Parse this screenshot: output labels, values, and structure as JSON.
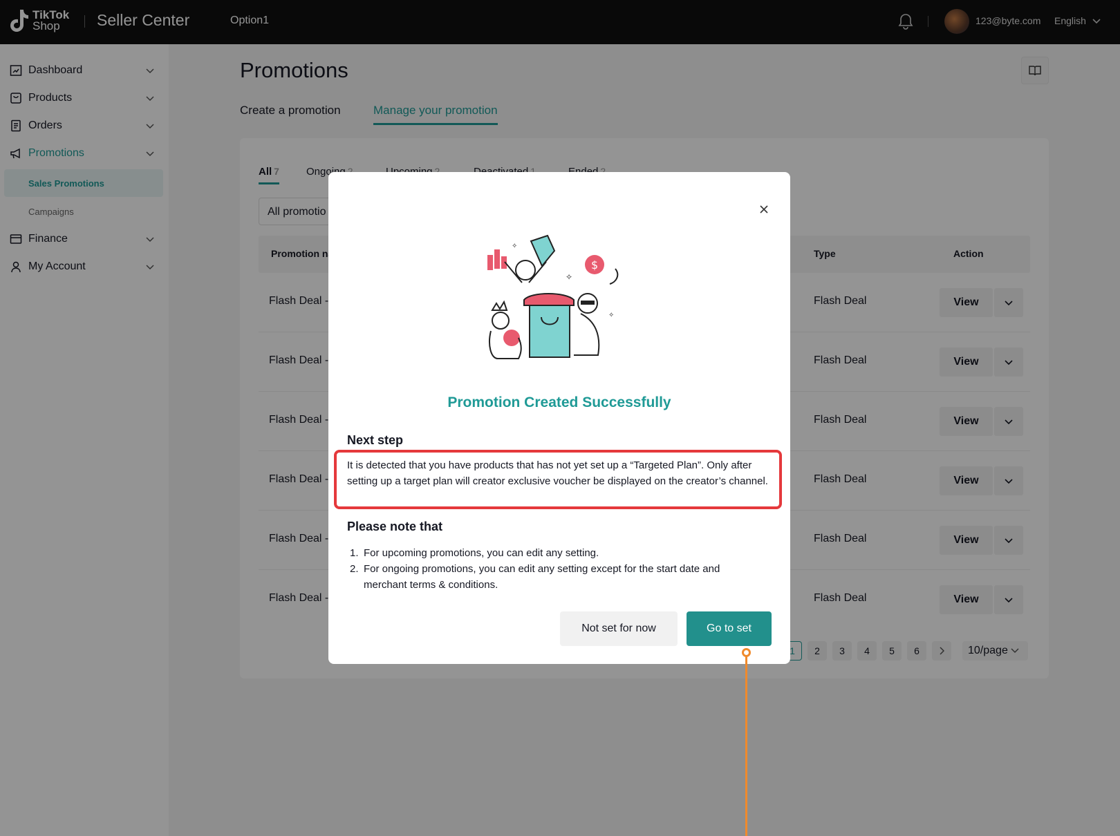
{
  "topbar": {
    "logo_line1": "TikTok",
    "logo_line2": "Shop",
    "app_title": "Seller Center",
    "option": "Option1",
    "email": "123@byte.com",
    "language": "English"
  },
  "sidebar": {
    "items": [
      {
        "label": "Dashboard",
        "icon": "dashboard-icon"
      },
      {
        "label": "Products",
        "icon": "products-icon"
      },
      {
        "label": "Orders",
        "icon": "orders-icon"
      },
      {
        "label": "Promotions",
        "icon": "megaphone-icon"
      },
      {
        "label": "Finance",
        "icon": "finance-icon"
      },
      {
        "label": "My Account",
        "icon": "user-icon"
      }
    ],
    "sub_items": [
      {
        "label": "Sales Promotions"
      },
      {
        "label": "Campaigns"
      }
    ]
  },
  "main": {
    "title": "Promotions",
    "tabs": [
      "Create a promotion",
      "Manage your promotion"
    ],
    "status_tabs": [
      {
        "label": "All",
        "count": "7"
      },
      {
        "label": "Ongoing",
        "count": "2"
      },
      {
        "label": "Upcoming",
        "count": "2"
      },
      {
        "label": "Deactivated",
        "count": "1"
      },
      {
        "label": "Ended",
        "count": "2"
      }
    ],
    "filter_value": "All promotio",
    "columns": [
      "Promotion na",
      "Type",
      "Action"
    ],
    "rows": [
      {
        "name": "Flash Deal -",
        "type": "Flash Deal",
        "action": "View"
      },
      {
        "name": "Flash Deal -",
        "type": "Flash Deal",
        "action": "View"
      },
      {
        "name": "Flash Deal -",
        "type": "Flash Deal",
        "action": "View"
      },
      {
        "name": "Flash Deal -",
        "type": "Flash Deal",
        "action": "View"
      },
      {
        "name": "Flash Deal -",
        "type": "Flash Deal",
        "action": "View"
      },
      {
        "name": "Flash Deal -",
        "type": "Flash Deal",
        "action": "View"
      }
    ],
    "pagination": {
      "pages": [
        "1",
        "2",
        "3",
        "4",
        "5",
        "6"
      ],
      "current": "1",
      "per_page": "10/page"
    }
  },
  "modal": {
    "title": "Promotion Created Successfully",
    "next_step_heading": "Next step",
    "next_step_text": "It is detected that you have products that has not yet set up a “Targeted Plan”. Only after setting up a target plan will creator exclusive voucher be displayed on the creator’s channel.",
    "note_heading": "Please note that",
    "notes": [
      "For upcoming promotions, you can edit any setting.",
      "For ongoing promotions, you can edit any setting except for the start date and merchant terms & conditions."
    ],
    "secondary_button": "Not set for now",
    "primary_button": "Go to set"
  },
  "colors": {
    "accent": "#1f9a96",
    "primary_button": "#22908c",
    "highlight_border": "#e5393c",
    "pointer": "#f08a2c",
    "topbar": "#111111"
  }
}
